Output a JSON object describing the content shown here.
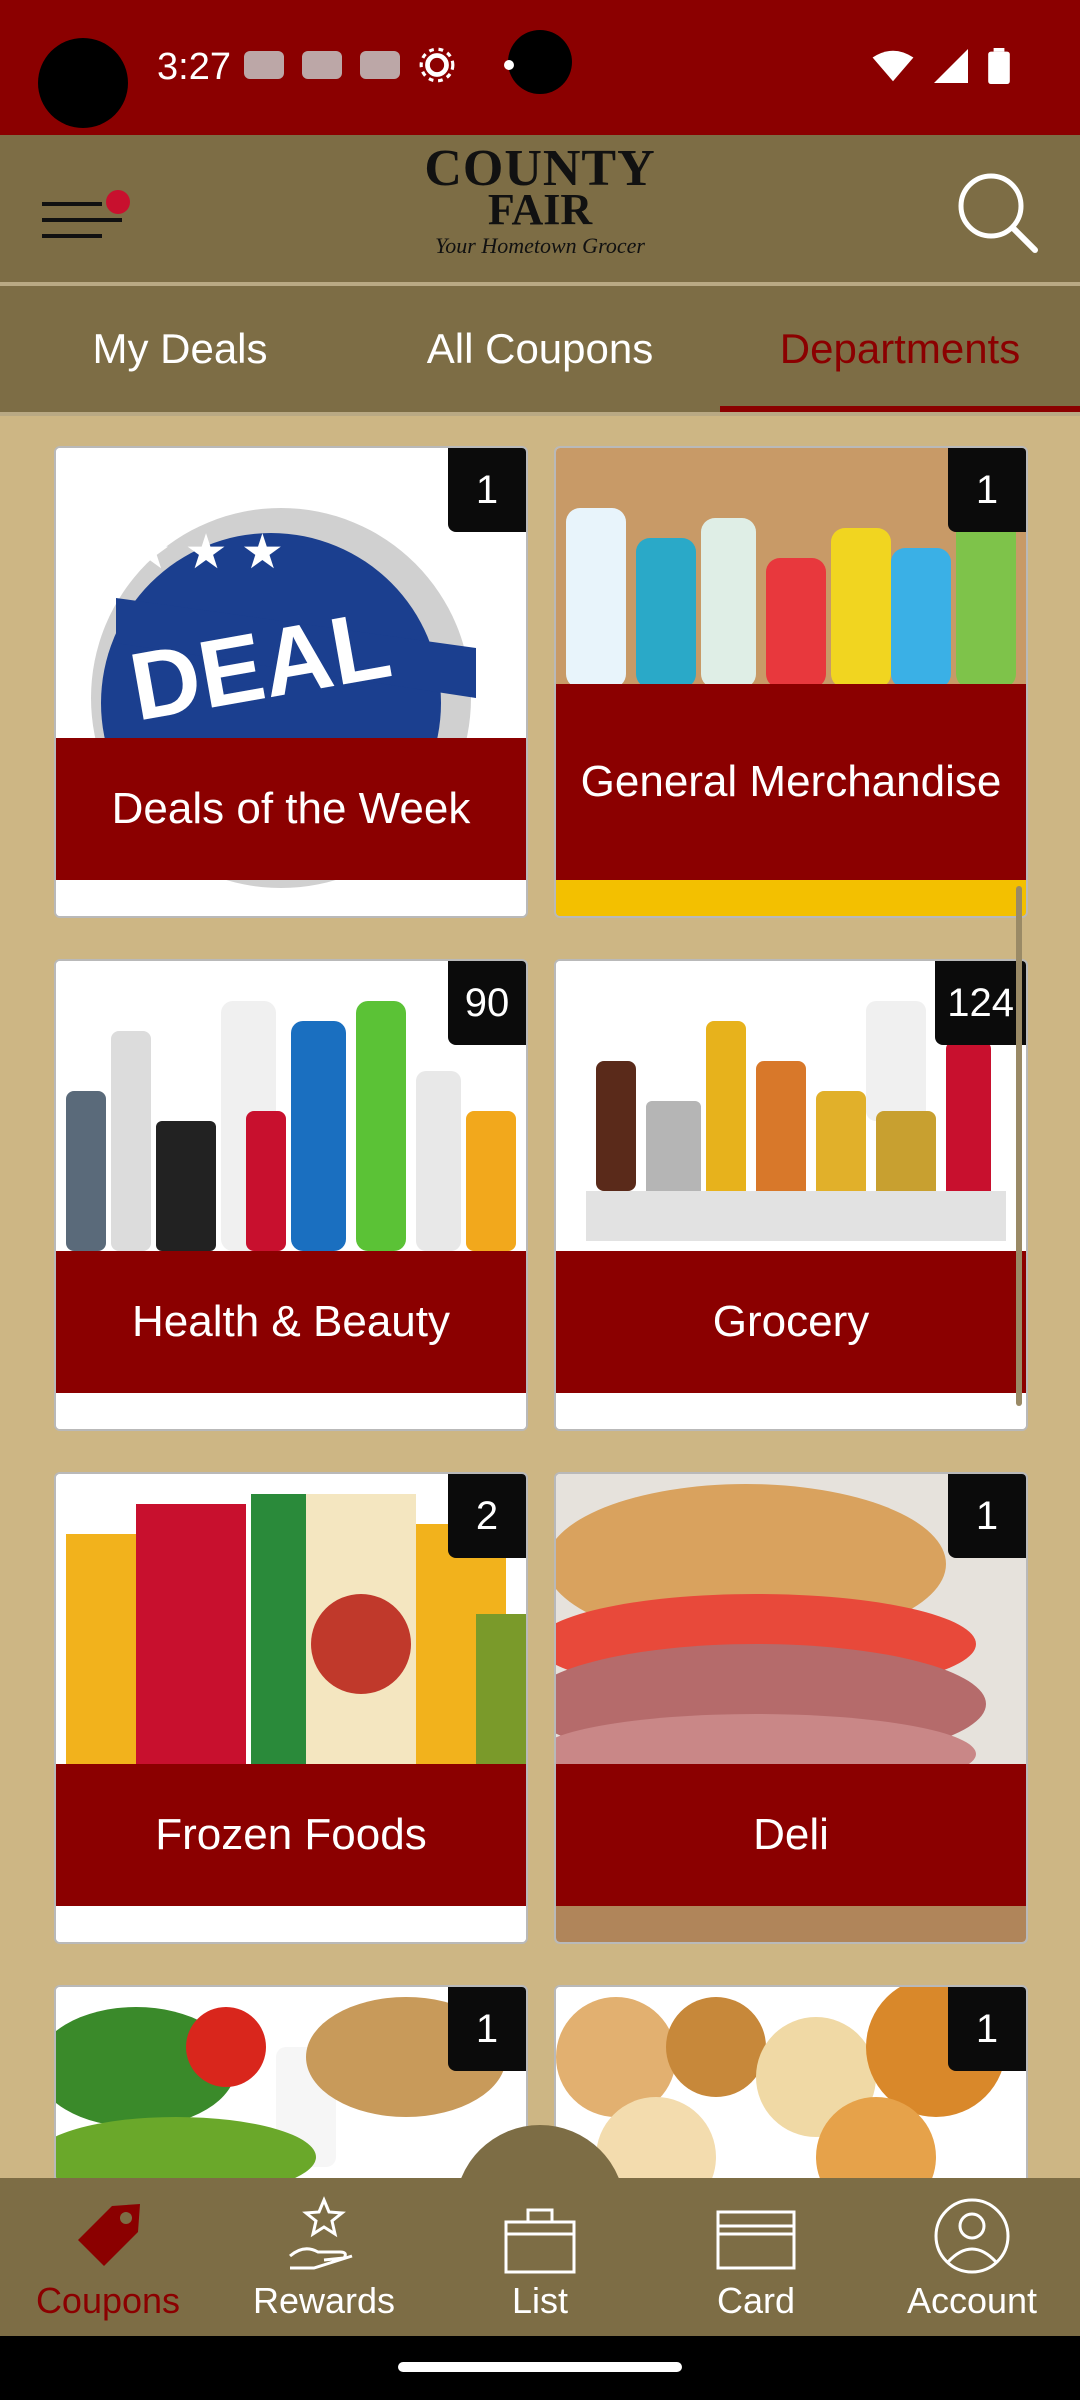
{
  "status_bar": {
    "time": "3:27"
  },
  "header": {
    "logo_line1": "COUNTY",
    "logo_line2": "FAIR",
    "logo_tagline": "Your Hometown Grocer"
  },
  "tabs": [
    {
      "label": "My Deals"
    },
    {
      "label": "All Coupons"
    },
    {
      "label": "Departments",
      "active": true
    }
  ],
  "departments": [
    {
      "label": "Deals of the Week",
      "count": "1"
    },
    {
      "label": "General Merchandise",
      "count": "1"
    },
    {
      "label": "Health & Beauty",
      "count": "90"
    },
    {
      "label": "Grocery",
      "count": "124"
    },
    {
      "label": "Frozen Foods",
      "count": "2"
    },
    {
      "label": "Deli",
      "count": "1"
    },
    {
      "label": "",
      "count": "1"
    },
    {
      "label": "",
      "count": "1"
    }
  ],
  "bottom_nav": [
    {
      "label": "Coupons",
      "icon": "tag-icon",
      "active": true
    },
    {
      "label": "Rewards",
      "icon": "hand-star-icon"
    },
    {
      "label": "List",
      "icon": "bag-icon"
    },
    {
      "label": "Card",
      "icon": "card-icon"
    },
    {
      "label": "Account",
      "icon": "user-icon"
    }
  ],
  "colors": {
    "primary": "#8b0000",
    "header": "#7d6d45",
    "background": "#cdb684"
  }
}
